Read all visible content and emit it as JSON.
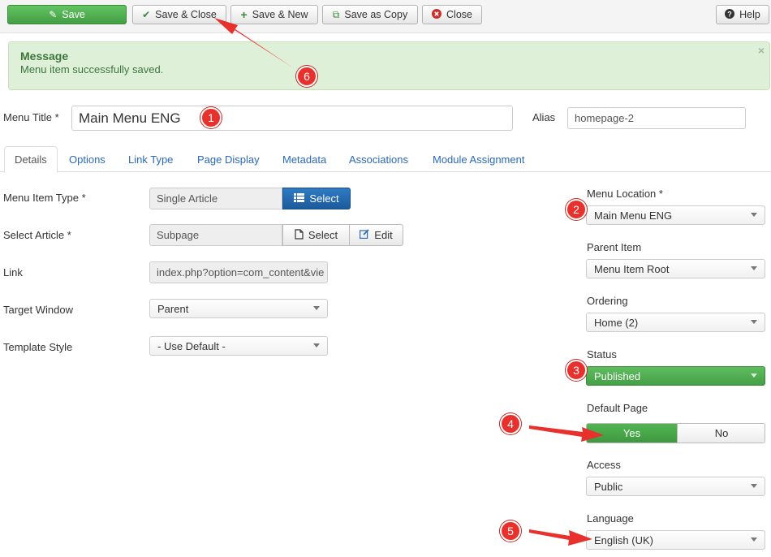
{
  "toolbar": {
    "save": "Save",
    "save_close": "Save & Close",
    "save_new": "Save & New",
    "save_copy": "Save as Copy",
    "close": "Close",
    "help": "Help"
  },
  "message": {
    "heading": "Message",
    "text": "Menu item successfully saved.",
    "close_glyph": "×"
  },
  "form": {
    "menu_title_label": "Menu Title *",
    "menu_title_value": "Main Menu ENG",
    "alias_label": "Alias",
    "alias_value": "homepage-2"
  },
  "tabs": [
    "Details",
    "Options",
    "Link Type",
    "Page Display",
    "Metadata",
    "Associations",
    "Module Assignment"
  ],
  "details": {
    "menu_item_type_label": "Menu Item Type *",
    "menu_item_type_value": "Single Article",
    "select_label": "Select",
    "select_article_label": "Select Article *",
    "select_article_value": "Subpage",
    "article_select_label": "Select",
    "edit_label": "Edit",
    "link_label": "Link",
    "link_value": "index.php?option=com_content&vie",
    "target_window_label": "Target Window",
    "target_window_value": "Parent",
    "template_style_label": "Template Style",
    "template_style_value": "- Use Default -"
  },
  "sidebar": {
    "menu_location_label": "Menu Location *",
    "menu_location_value": "Main Menu ENG",
    "parent_item_label": "Parent Item",
    "parent_item_value": "Menu Item Root",
    "ordering_label": "Ordering",
    "ordering_value": "Home (2)",
    "status_label": "Status",
    "status_value": "Published",
    "default_page_label": "Default Page",
    "default_yes": "Yes",
    "default_no": "No",
    "access_label": "Access",
    "access_value": "Public",
    "language_label": "Language",
    "language_value": "English (UK)"
  },
  "annotations": [
    "1",
    "2",
    "3",
    "4",
    "5",
    "6"
  ],
  "colors": {
    "green": "#46a046",
    "blue": "#1c5a9c",
    "link": "#2a69b8",
    "annotation": "#e8302c",
    "message_bg": "#dff0d8"
  }
}
